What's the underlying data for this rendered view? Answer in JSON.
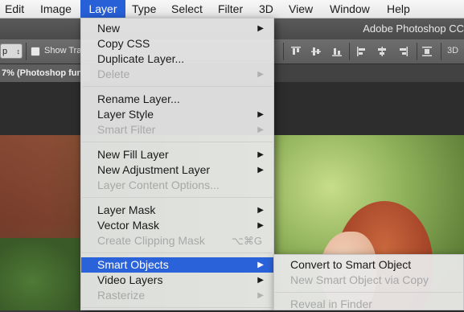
{
  "menubar": {
    "items": [
      {
        "label": "Edit"
      },
      {
        "label": "Image"
      },
      {
        "label": "Layer"
      },
      {
        "label": "Type"
      },
      {
        "label": "Select"
      },
      {
        "label": "Filter"
      },
      {
        "label": "3D"
      },
      {
        "label": "View"
      },
      {
        "label": "Window"
      },
      {
        "label": "Help"
      }
    ],
    "active_label": "Layer"
  },
  "window": {
    "title": "Adobe Photoshop CC"
  },
  "options_bar": {
    "select_value": "p",
    "select_arrow": "↕",
    "show_transform_label": "Show Tra",
    "threed_label": "3D",
    "align_icons": [
      "align-top-edges-icon",
      "align-vertical-centers-icon",
      "align-bottom-edges-icon",
      "align-left-edges-icon",
      "align-horizontal-centers-icon",
      "align-right-edges-icon"
    ]
  },
  "document": {
    "tab_label": "7% (Photoshop fun"
  },
  "layer_menu": {
    "items": [
      {
        "label": "New",
        "submenu": true,
        "disabled": false
      },
      {
        "label": "Copy CSS",
        "submenu": false,
        "disabled": false
      },
      {
        "label": "Duplicate Layer...",
        "submenu": false,
        "disabled": false
      },
      {
        "label": "Delete",
        "submenu": true,
        "disabled": true
      },
      {
        "label": "Rename Layer...",
        "submenu": false,
        "disabled": false
      },
      {
        "label": "Layer Style",
        "submenu": true,
        "disabled": false
      },
      {
        "label": "Smart Filter",
        "submenu": true,
        "disabled": true
      },
      {
        "label": "New Fill Layer",
        "submenu": true,
        "disabled": false
      },
      {
        "label": "New Adjustment Layer",
        "submenu": true,
        "disabled": false
      },
      {
        "label": "Layer Content Options...",
        "submenu": false,
        "disabled": true
      },
      {
        "label": "Layer Mask",
        "submenu": true,
        "disabled": false
      },
      {
        "label": "Vector Mask",
        "submenu": true,
        "disabled": false
      },
      {
        "label": "Create Clipping Mask",
        "submenu": false,
        "disabled": true,
        "shortcut": "⌥⌘G"
      },
      {
        "label": "Smart Objects",
        "submenu": true,
        "disabled": false,
        "highlighted": true
      },
      {
        "label": "Video Layers",
        "submenu": true,
        "disabled": false
      },
      {
        "label": "Rasterize",
        "submenu": true,
        "disabled": true
      }
    ]
  },
  "smart_objects_submenu": {
    "items": [
      {
        "label": "Convert to Smart Object",
        "disabled": false
      },
      {
        "label": "New Smart Object via Copy",
        "disabled": true
      },
      {
        "label": "Reveal in Finder",
        "disabled": true
      }
    ]
  },
  "colors": {
    "menu_highlight": "#2a62d9",
    "disabled_text": "#a8a8a8"
  }
}
